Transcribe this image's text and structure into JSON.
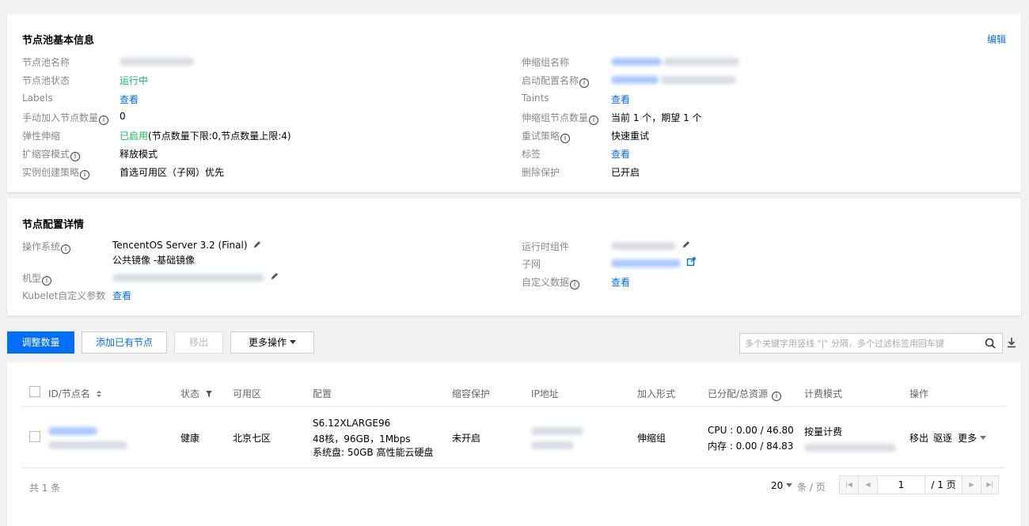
{
  "basic": {
    "title": "节点池基本信息",
    "edit": "编辑",
    "left": [
      {
        "label": "节点池名称",
        "value": "",
        "blur": true,
        "info": false
      },
      {
        "label": "节点池状态",
        "value": "运行中",
        "style": "green",
        "info": false
      },
      {
        "label": "Labels",
        "value": "查看",
        "style": "link",
        "info": false
      },
      {
        "label": "手动加入节点数量",
        "value": "0",
        "info": true
      },
      {
        "label": "弹性伸缩",
        "value_green": "已启用",
        "value_suffix": "(节点数量下限:0,节点数量上限:4)",
        "info": false
      },
      {
        "label": "扩缩容模式",
        "value": "释放模式",
        "info": true
      },
      {
        "label": "实例创建策略",
        "value": "首选可用区（子网）优先",
        "info": true
      }
    ],
    "right": [
      {
        "label": "伸缩组名称",
        "blur": true,
        "info": false
      },
      {
        "label": "启动配置名称",
        "blur": true,
        "info": true
      },
      {
        "label": "Taints",
        "value": "查看",
        "style": "link",
        "info": false
      },
      {
        "label": "伸缩组节点数量",
        "value": "当前 1 个，期望 1 个",
        "info": true
      },
      {
        "label": "重试策略",
        "value": "快速重试",
        "info": true
      },
      {
        "label": "标签",
        "value": "查看",
        "style": "link",
        "info": false
      },
      {
        "label": "删除保护",
        "value": "已开启",
        "info": false
      }
    ]
  },
  "config": {
    "title": "节点配置详情",
    "os_label": "操作系统",
    "os_value": "TencentOS Server 3.2 (Final)",
    "os_sub": "公共镜像 -基础镜像",
    "model_label": "机型",
    "kubelet_label": "Kubelet自定义参数",
    "kubelet_value": "查看",
    "runtime_label": "运行时组件",
    "subnet_label": "子网",
    "userdata_label": "自定义数据",
    "userdata_value": "查看"
  },
  "toolbar": {
    "adjust": "调整数量",
    "add_existing": "添加已有节点",
    "remove": "移出",
    "more_ops": "更多操作",
    "search_placeholder": "多个关键字用竖线 \"|\" 分隔，多个过滤标签用回车键"
  },
  "table": {
    "headers": {
      "id": "ID/节点名",
      "status": "状态",
      "zone": "可用区",
      "config": "配置",
      "scale_protect": "缩容保护",
      "ip": "IP地址",
      "join_mode": "加入形式",
      "allocated": "已分配/总资源",
      "billing": "计费模式",
      "ops": "操作"
    },
    "row": {
      "status": "健康",
      "zone": "北京七区",
      "config_line1": "S6.12XLARGE96",
      "config_line2": "48核，96GB，1Mbps",
      "config_line3": "系统盘: 50GB 高性能云硬盘",
      "scale_protect": "未开启",
      "join_mode": "伸缩组",
      "cpu": "CPU : 0.00 / 46.80",
      "mem": "内存 : 0.00 / 84.83",
      "billing": "按量计费",
      "op_remove": "移出",
      "op_evict": "驱逐",
      "op_more": "更多"
    },
    "footer": {
      "total": "共 1 条",
      "page_size": "20",
      "page_size_unit": "条 / 页",
      "page_input": "1",
      "page_total": "/ 1 页"
    }
  }
}
